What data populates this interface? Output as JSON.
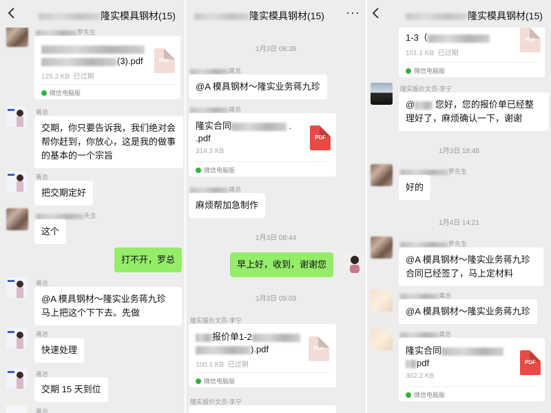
{
  "chat_title": "隆实模具钢材(15)",
  "panel1": {
    "file1": {
      "name": "(3).pdf",
      "size": "125.2 KB",
      "status": "已过期",
      "source": "微信电脑版",
      "icon": "PDF"
    },
    "msg1": {
      "sender": "罗先生"
    },
    "msg2": {
      "sender": "蒋总",
      "text": "交期，你只要告诉我，我们绝对会帮你赶到，你放心，这是我的做事的基本的一个宗旨"
    },
    "msg3": {
      "sender": "蒋总",
      "text": "把交期定好"
    },
    "msg4": {
      "sender": "先生",
      "text": "这个"
    },
    "msg5": {
      "text": "打不开，罗总"
    },
    "msg6": {
      "sender": "蒋总",
      "text": "@A 模具钢材～隆实业务蒋九珍 马上把这个下下去。先做"
    },
    "msg7": {
      "sender": "蒋总",
      "text": "快速处理"
    },
    "msg8": {
      "sender": "蒋总",
      "text": "交期 15 天到位"
    },
    "msg9": {
      "sender": "蒋总"
    }
  },
  "panel2": {
    "time1": "1月3日 08:39",
    "msg1": {
      "sender": "龚总",
      "text": "@A 模具钢材～隆实业务蒋九珍"
    },
    "file1": {
      "sender": "龚总",
      "name_prefix": "隆实合同",
      "name_suffix": ".pdf",
      "size": "314.3 KB",
      "source": "微信电脑版",
      "icon": "PDF"
    },
    "msg2": {
      "sender": "龚总",
      "text": "麻烦帮加急制作"
    },
    "time2": "1月3日 08:44",
    "msg3": {
      "text": "早上好，收到，谢谢您"
    },
    "time3": "1月3日 09:03",
    "file2": {
      "sender": "隆实报价文员-李宁",
      "name_prefix": "报价单1-2",
      "name_suffix": ").pdf",
      "size": "100.1 KB",
      "status": "已过期",
      "source": "微信电脑版",
      "icon": "PDF"
    },
    "msg4": {
      "sender": "隆实报价文员-李宁"
    }
  },
  "panel3": {
    "file1": {
      "name": "1-3（",
      "size": "101.1 KB",
      "status": "已过期",
      "source": "微信电脑版",
      "icon": "PDF"
    },
    "msg1": {
      "sender": "隆实报价文员-李宁",
      "text_prefix": "@",
      "text": "您好，您的报价单已经整理好了，麻烦确认一下，谢谢"
    },
    "time1": "1月3日 18:48",
    "msg2": {
      "sender": "罗先生",
      "text": "好的"
    },
    "time2": "1月4日 14:21",
    "msg3": {
      "sender": "罗先生",
      "text": "@A 模具钢材～隆实业务蒋九珍 合同已经签了，马上定材料"
    },
    "msg4": {
      "sender": "龚总",
      "text": "@A 模具钢材～隆实业务蒋九珍"
    },
    "file2": {
      "sender": "龚总",
      "name_prefix": "隆实合同",
      "name_suffix": "pdf",
      "size": "302.2 KB",
      "source": "微信电脑版",
      "icon": "PDF"
    }
  },
  "colors": {
    "bg": "#ededed",
    "bubble_self": "#95ec69",
    "pdf_red": "#e84a45",
    "source_dot": "#31b33b"
  },
  "icons": {
    "back": "chevron-left-icon",
    "more": "more-dots-icon",
    "file": "pdf-file-icon"
  }
}
